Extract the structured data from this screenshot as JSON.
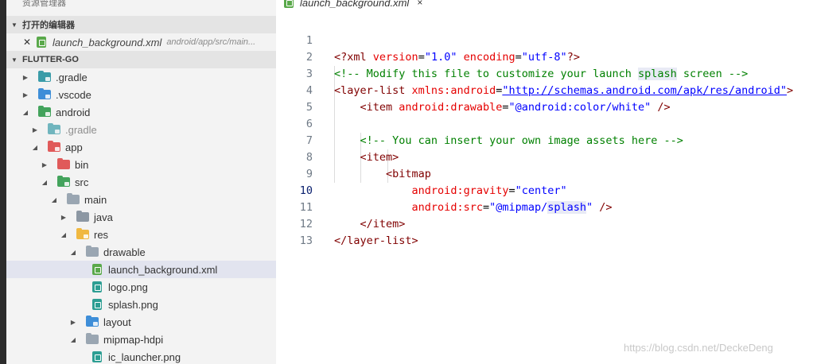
{
  "explorer": {
    "title": "资源管理器",
    "open_editors": {
      "label": "打开的编辑器",
      "items": [
        {
          "name": "launch_background.xml",
          "path": "android/app/src/main..."
        }
      ]
    },
    "workspace": {
      "label": "FLUTTER-GO",
      "tree": [
        {
          "name": ".gradle"
        },
        {
          "name": ".vscode"
        },
        {
          "name": "android"
        },
        {
          "name": ".gradle"
        },
        {
          "name": "app"
        },
        {
          "name": "bin"
        },
        {
          "name": "src"
        },
        {
          "name": "main"
        },
        {
          "name": "java"
        },
        {
          "name": "res"
        },
        {
          "name": "drawable"
        },
        {
          "name": "launch_background.xml"
        },
        {
          "name": "logo.png"
        },
        {
          "name": "splash.png"
        },
        {
          "name": "layout"
        },
        {
          "name": "mipmap-hdpi"
        },
        {
          "name": "ic_launcher.png"
        }
      ]
    }
  },
  "editor": {
    "tab": {
      "title": "launch_background.xml",
      "close_glyph": "×"
    },
    "current_line": 10,
    "lines": [
      {
        "n": "1"
      },
      {
        "n": "2"
      },
      {
        "n": "3"
      },
      {
        "n": "4"
      },
      {
        "n": "5"
      },
      {
        "n": "6"
      },
      {
        "n": "7"
      },
      {
        "n": "8"
      },
      {
        "n": "9"
      },
      {
        "n": "10"
      },
      {
        "n": "11"
      },
      {
        "n": "12"
      },
      {
        "n": "13"
      }
    ],
    "tokens": {
      "l1_open": "<?xml",
      "l1_version_attr": "version",
      "l1_version_val": "\"1.0\"",
      "l1_encoding_attr": "encoding",
      "l1_encoding_val": "\"utf-8\"",
      "l1_close": "?>",
      "l2_comment_a": "<!-- Modify this file to customize your launch ",
      "l2_comment_hl": "splash",
      "l2_comment_b": " screen -->",
      "l3_tag": "<layer-list",
      "l3_attr": "xmlns:android",
      "l3_val_link": "\"http://schemas.android.com/apk/res/android\"",
      "l3_close": ">",
      "l4_tag": "<item",
      "l4_attr": "android:drawable",
      "l4_val": "\"@android:color/white\"",
      "l4_close": " />",
      "l6_comment": "<!-- You can insert your own image assets here -->",
      "l7_tag": "<item>",
      "l8_tag": "<bitmap",
      "l9_attr": "android:gravity",
      "l9_val": "\"center\"",
      "l10_attr": "android:src",
      "l10_val_a": "\"@mipmap/",
      "l10_val_hl": "splash",
      "l10_val_b": "\"",
      "l10_close": " />",
      "l11_tag": "</item>",
      "l12_tag": "</layer-list>"
    }
  },
  "watermark": "https://blog.csdn.net/DeckeDeng"
}
